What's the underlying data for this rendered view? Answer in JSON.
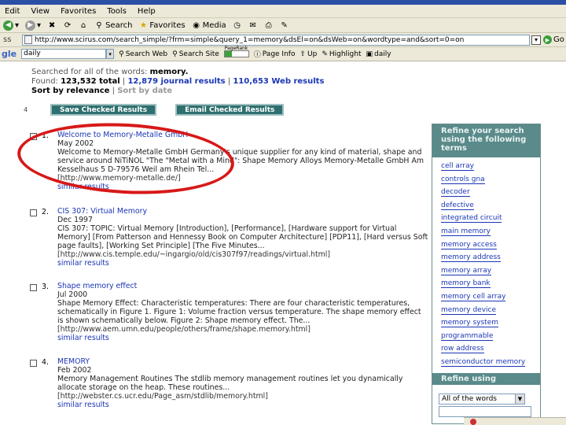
{
  "menu": [
    "Edit",
    "View",
    "Favorites",
    "Tools",
    "Help"
  ],
  "toolbar": {
    "search_label": "Search",
    "favorites_label": "Favorites",
    "media_label": "Media"
  },
  "address": {
    "label": "ss",
    "url": "http://www.scirus.com/search_simple/?frm=simple&query_1=memory&dsEl=on&dsWeb=on&wordtype=and&sort=0=on",
    "go_label": "Go"
  },
  "googlebar": {
    "logo": "gle",
    "query": "daily",
    "search_web": "Search Web",
    "search_site": "Search Site",
    "pagerank_label": "PageRank",
    "page_info": "Page Info",
    "up": "Up",
    "highlight": "Highlight",
    "daily": "daily"
  },
  "summary": {
    "searched_prefix": "Searched for all of the words:",
    "query": "memory.",
    "found_label": "Found:",
    "total": "123,532 total",
    "journal": "12,879 journal results",
    "web": "110,653 Web results",
    "sort_relevance": "Sort by relevance",
    "sort_date": "Sort by date"
  },
  "actions": {
    "page_marker": "4",
    "save": "Save Checked Results",
    "email": "Email Checked Results"
  },
  "results": [
    {
      "num": "1.",
      "title": "Welcome to Memory-Metalle GmbH",
      "date": "May 2002",
      "snippet": "Welcome to Memory-Metalle GmbH Germany's unique supplier for any kind of material, shape and service around NiTiNOL \"The \"Metal with a Mind\": Shape Memory Alloys Memory-Metalle GmbH Am Kesselhaus 5 D-79576 Weil am Rhein Tel...",
      "url": "[http://www.memory-metalle.de/]",
      "similar": "similar results"
    },
    {
      "num": "2.",
      "title": "CIS 307: Virtual Memory",
      "date": "Dec 1997",
      "snippet": "CIS 307: TOPIC: Virtual Memory [Introduction], [Performance], [Hardware support for Virtual Memory] [From Patterson and Hennessy Book on Computer Architecture] [PDP11], [Hard versus Soft page faults], [Working Set Principle] [The Five Minutes...",
      "url": "[http://www.cis.temple.edu/~ingargio/old/cis307f97/readings/virtual.html]",
      "similar": "similar results"
    },
    {
      "num": "3.",
      "title": "Shape memory effect",
      "date": "Jul 2000",
      "snippet": "Shape Memory Effect: Characteristic temperatures: There are four characteristic temperatures, schematically in Figure 1. Figure 1: Volume fraction versus temperature. The shape memory effect is shown schematically below. Figure 2: Shape memory effect. The...",
      "url": "[http://www.aem.umn.edu/people/others/frame/shape.memory.html]",
      "similar": "similar results"
    },
    {
      "num": "4.",
      "title": "MEMORY",
      "date": "Feb 2002",
      "snippet": "Memory Management Routines The stdlib memory management routines let you dynamically allocate storage on the heap. These routines...",
      "url": "[http://webster.cs.ucr.edu/Page_asm/stdlib/memory.html]",
      "similar": "similar results"
    }
  ],
  "refine": {
    "heading": "Refine your search using the following terms",
    "terms": [
      "cell array",
      "controls gna",
      "decoder",
      "defective",
      "integrated circuit",
      "main memory",
      "memory access",
      "memory address",
      "memory array",
      "memory bank",
      "memory cell array",
      "memory device",
      "memory system",
      "programmable",
      "row address",
      "semiconductor memory"
    ],
    "using_heading": "Refine using",
    "select_value": "All of the words"
  },
  "colors": {
    "panel_teal": "#5a8a8a",
    "link_blue": "#1a36b5",
    "annotation_red": "#d81818"
  }
}
